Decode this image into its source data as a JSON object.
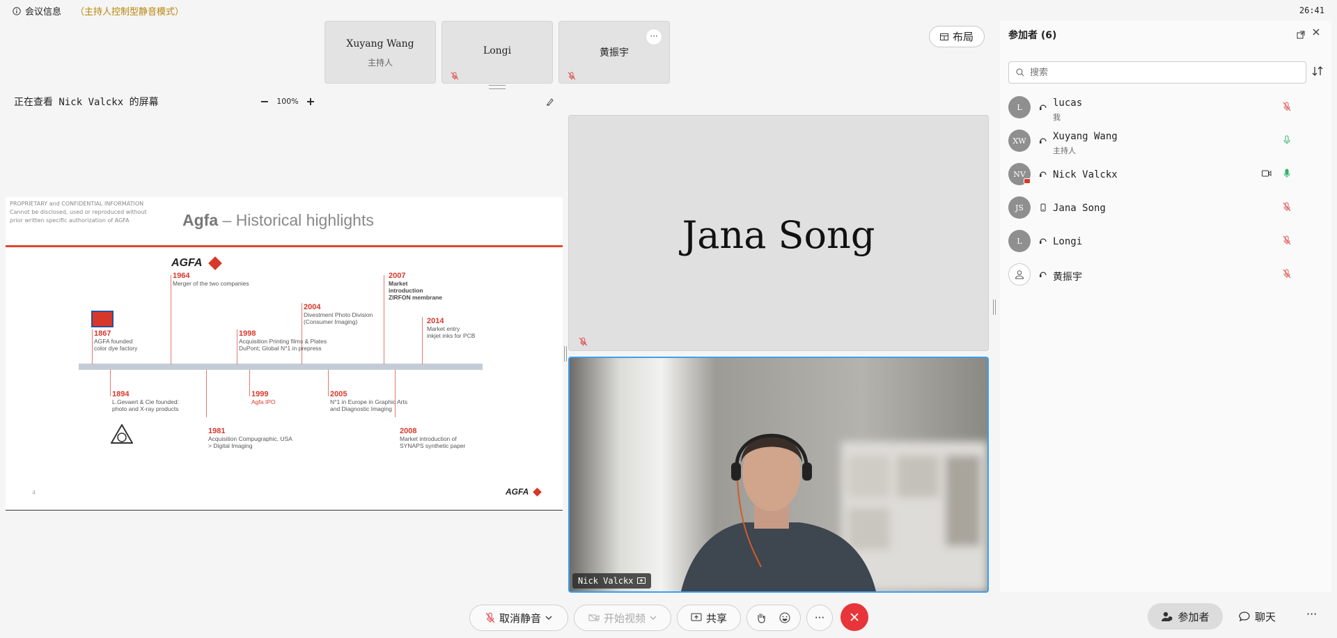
{
  "topbar": {
    "info_label": "会议信息",
    "mode_label": "（主持人控制型静音模式）",
    "clock": "26:41"
  },
  "thumbs": [
    {
      "name": "Xuyang Wang",
      "role": "主持人"
    },
    {
      "name": "Longi",
      "role": ""
    },
    {
      "name": "黄振宇",
      "role": "",
      "more": "···"
    }
  ],
  "layout_btn": "布局",
  "viewer": {
    "viewing_text": "正在查看 Nick Valckx 的屏幕",
    "zoom": "100%",
    "zoom_minus": "−",
    "zoom_plus": "+"
  },
  "slide": {
    "confidential": "PROPRIETARY and CONFIDENTIAL INFORMATION\nCannot be disclosed, used or reproduced without\nprior written specific authorization of AGFA",
    "title_bold": "Agfa",
    "title_rest": " – Historical highlights",
    "logo_text": "AGFA",
    "footer_logo": "AGFA",
    "page_number": "4",
    "events": [
      {
        "year": "1867",
        "text": "AGFA founded\ncolor dye factory"
      },
      {
        "year": "1894",
        "text": "L.Gevaert & Cie founded:\nphoto and X-ray products"
      },
      {
        "year": "1964",
        "text": "Merger of the two companies"
      },
      {
        "year": "1981",
        "text": "Acquisition Compugraphic, USA\n> Digital Imaging"
      },
      {
        "year": "1998",
        "text": "Acquisition Printing films & Plates\nDuPont; Global N°1 in prepress"
      },
      {
        "year": "1999",
        "text": "Agfa IPO"
      },
      {
        "year": "2004",
        "text": "Divestment Photo Division\n(Consumer Imaging)"
      },
      {
        "year": "2005",
        "text": "N°1 in Europe in Graphic Arts\nand Diagnostic Imaging"
      },
      {
        "year": "2007",
        "text": "Market\nintroduction\nZIRFON membrane"
      },
      {
        "year": "2008",
        "text": "Market introduction of\nSYNAPS synthetic paper"
      },
      {
        "year": "2014",
        "text": "Market entry\ninkjet inks for PCB"
      }
    ]
  },
  "tiles": {
    "jana": "Jana Song",
    "nick": "Nick Valckx"
  },
  "panel": {
    "title": "参加者 (6)",
    "search_placeholder": "搜索",
    "participants": [
      {
        "initials": "L",
        "name": "lucas",
        "role": "我",
        "mic": "muted"
      },
      {
        "initials": "XW",
        "name": "Xuyang Wang",
        "role": "主持人",
        "mic": "on"
      },
      {
        "initials": "NV",
        "name": "Nick Valckx",
        "role": "",
        "mic": "speaking",
        "camera": true
      },
      {
        "initials": "JS",
        "name": "Jana Song",
        "role": "",
        "mic": "muted"
      },
      {
        "initials": "L",
        "name": "Longi",
        "role": "",
        "mic": "muted"
      },
      {
        "initials": "",
        "name": "黄振宇",
        "role": "",
        "mic": "muted"
      }
    ]
  },
  "toolbar": {
    "unmute": "取消静音",
    "video": "开始视频",
    "share": "共享",
    "more": "···",
    "participants": "参加者",
    "chat": "聊天",
    "more2": "···"
  },
  "colors": {
    "accent_blue": "#3aa0f0",
    "leave_red": "#e8353a",
    "muted_red": "#e05555",
    "speaking_green": "#2fb36b",
    "agfa_red": "#d8382a"
  }
}
